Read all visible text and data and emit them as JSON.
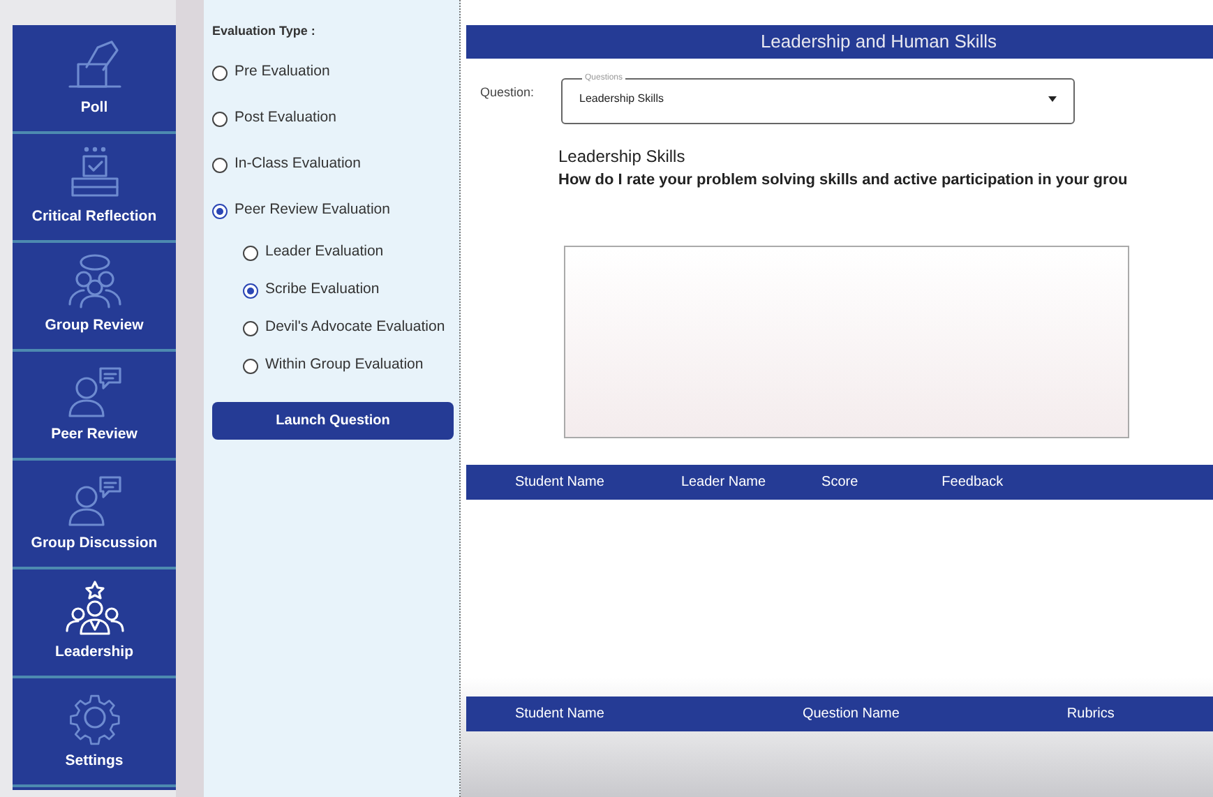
{
  "sidebar": {
    "items": [
      {
        "label": "Poll",
        "selected": false
      },
      {
        "label": "Critical Reflection",
        "selected": false
      },
      {
        "label": "Group Review",
        "selected": false
      },
      {
        "label": "Peer Review",
        "selected": false
      },
      {
        "label": "Group Discussion",
        "selected": false
      },
      {
        "label": "Leadership",
        "selected": true
      },
      {
        "label": "Settings",
        "selected": false
      }
    ]
  },
  "evaluation": {
    "title": "Evaluation Type :",
    "options": [
      {
        "label": "Pre Evaluation",
        "selected": false
      },
      {
        "label": "Post Evaluation",
        "selected": false
      },
      {
        "label": "In-Class Evaluation",
        "selected": false
      },
      {
        "label": "Peer Review Evaluation",
        "selected": true,
        "children": [
          {
            "label": "Leader Evaluation",
            "selected": false
          },
          {
            "label": "Scribe Evaluation",
            "selected": true
          },
          {
            "label": "Devil's Advocate Evaluation",
            "selected": false
          },
          {
            "label": "Within Group Evaluation",
            "selected": false
          }
        ]
      }
    ],
    "button": "Launch Question"
  },
  "main": {
    "title": "Leadership and Human Skills",
    "question_label": "Question:",
    "dropdown": {
      "label": "Questions",
      "value": "Leadership Skills"
    },
    "heading": "Leadership Skills",
    "prompt": "How do I rate your problem solving skills and active participation in your grou",
    "table1": {
      "columns": [
        "Student Name",
        "Leader Name",
        "Score",
        "Feedback"
      ]
    },
    "table2": {
      "columns": [
        "Student Name",
        "Question Name",
        "Rubrics"
      ]
    }
  }
}
